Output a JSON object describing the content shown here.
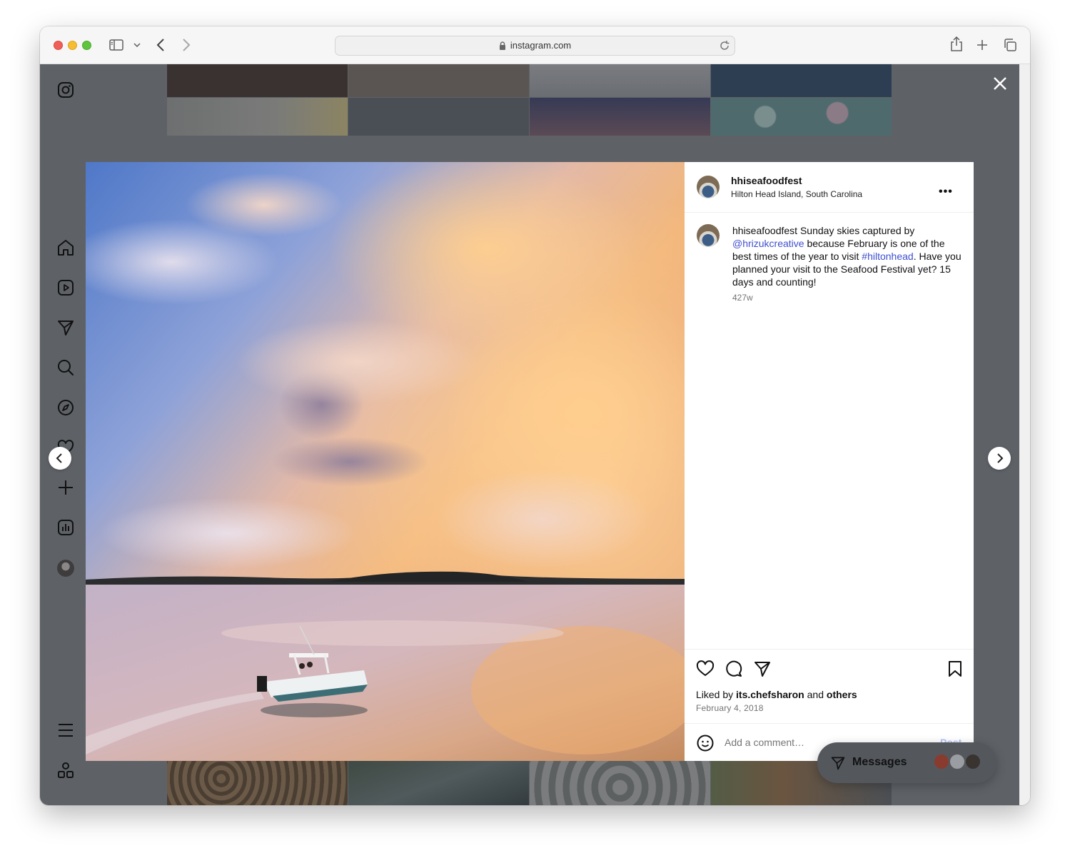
{
  "browser": {
    "url": "instagram.com"
  },
  "post": {
    "username": "hhiseafoodfest",
    "location": "Hilton Head Island, South Carolina",
    "caption": {
      "author": "hhiseafoodfest",
      "text_1": " Sunday skies captured by ",
      "mention": "@hrizukcreative",
      "text_2": " because February is one of the best times of the year to visit ",
      "hashtag": "#hiltonhead",
      "text_3": ". Have you planned your visit to the Seafood Festival yet? 15 days and counting!"
    },
    "age": "427w",
    "likes": {
      "prefix": "Liked by ",
      "user": "its.chefsharon",
      "middle": " and ",
      "others": "others"
    },
    "date": "February 4, 2018",
    "comment_placeholder": "Add a comment…",
    "post_label": "Post",
    "more_label": "•••"
  },
  "messages": {
    "label": "Messages"
  },
  "colors": {
    "link": "#3f4fcf",
    "overlay": "#5e6267",
    "post_button": "#b3c4f5"
  }
}
